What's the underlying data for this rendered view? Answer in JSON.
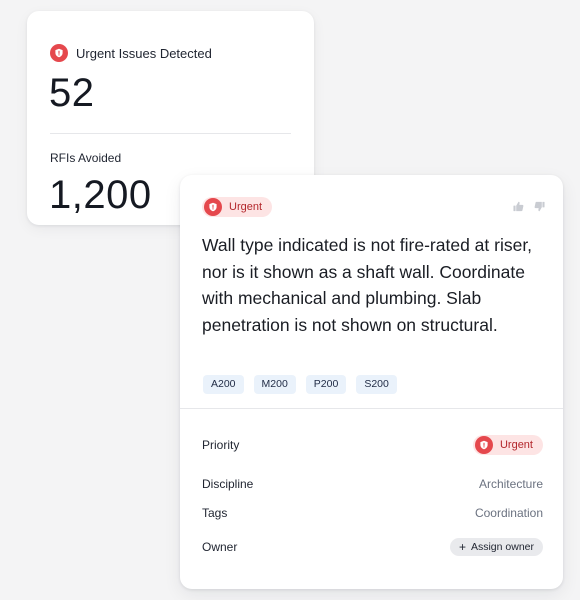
{
  "stats": {
    "urgent_label": "Urgent Issues Detected",
    "urgent_value": "52",
    "rfis_label": "RFIs Avoided",
    "rfis_value": "1,200"
  },
  "issue": {
    "priority_badge": "Urgent",
    "description": "Wall type indicated is not fire-rated at riser, nor is it shown as a shaft wall. Coordinate with mechanical and plumbing. Slab penetration is not shown on structural.",
    "tags": [
      "A200",
      "M200",
      "P200",
      "S200"
    ],
    "fields": {
      "priority_label": "Priority",
      "priority_value": "Urgent",
      "discipline_label": "Discipline",
      "discipline_value": "Architecture",
      "tags_label": "Tags",
      "tags_value": "Coordination",
      "owner_label": "Owner",
      "assign_owner_label": "Assign owner",
      "assign_owner_icon": "+"
    }
  },
  "colors": {
    "urgent_red": "#e5484d",
    "urgent_bg": "#fde4e4",
    "tag_bg": "#eaf2fb",
    "page_bg": "#f4f4f5"
  },
  "icons": {
    "urgent": "shield-alert-icon",
    "thumbs_up": "thumbs-up-icon",
    "thumbs_down": "thumbs-down-icon"
  }
}
